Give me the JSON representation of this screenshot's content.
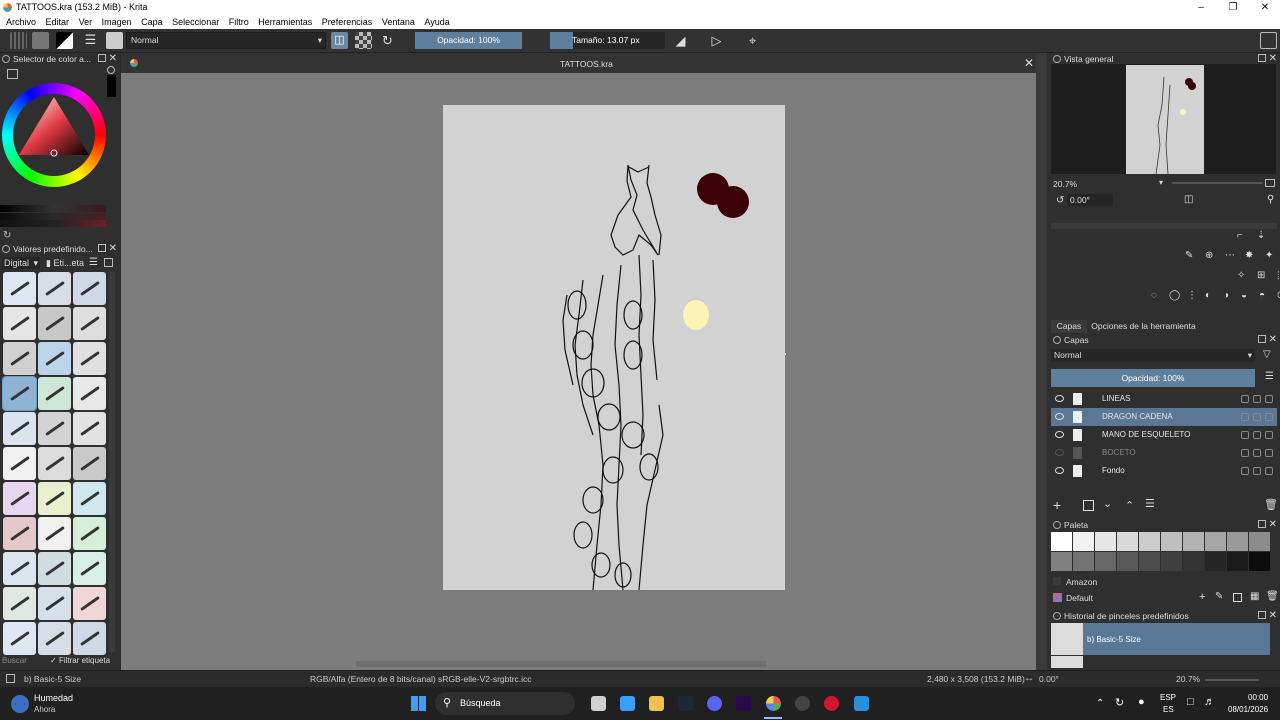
{
  "window": {
    "title": "TATTOOS.kra (153.2 MiB)  - Krita"
  },
  "menubar": [
    "Archivo",
    "Editar",
    "Ver",
    "Imagen",
    "Capa",
    "Seleccionar",
    "Filtro",
    "Herramientas",
    "Preferencias",
    "Ventana",
    "Ayuda"
  ],
  "toolbar": {
    "blend_mode": "Normal",
    "opacity": "Opacidad: 100%",
    "size": "Tamaño: 13.07 px"
  },
  "left_panels": {
    "color_selector_title": "Selector de color a...",
    "presets_title": "Valores predefinido...",
    "presets_filter": "Digital",
    "presets_tag": "Eti...eta",
    "search_placeholder": "Buscar",
    "filter_tag_label": "Filtrar etiqueta"
  },
  "canvas": {
    "tab_title": "TATTOOS.kra"
  },
  "right_panels": {
    "overview_title": "Vista general",
    "zoom": "20.7%",
    "rotation": "0.00°",
    "tabs": [
      "Capas",
      "Opciones de la herramienta"
    ],
    "layers_title": "Capas",
    "layer_blend": "Normal",
    "layer_opacity": "Opacidad:  100%",
    "layers": [
      {
        "name": "LINEAS",
        "visible": true,
        "selected": false
      },
      {
        "name": "DRAGON CADENA",
        "visible": true,
        "selected": true
      },
      {
        "name": "MANO DE ESQUELETO",
        "visible": true,
        "selected": false
      },
      {
        "name": "BOCETO",
        "visible": false,
        "selected": false
      },
      {
        "name": "Fondo",
        "visible": true,
        "selected": false
      }
    ],
    "palette_title": "Paleta",
    "palette_name": "Amazon",
    "palette_set": "Default",
    "history_title": "Historial de pinceles predefinidos",
    "history_item": "b) Basic-5 Size"
  },
  "statusbar": {
    "brush": "b) Basic-5 Size",
    "colorspace": "RGB/Alfa (Entero de 8 bits/canal)  sRGB-elle-V2-srgbtrc.icc",
    "dimensions": "2,480 x 3,508 (153.2 MiB)",
    "rotation": "0.00°",
    "zoom": "20.7%"
  },
  "taskbar": {
    "weather_title": "Humedad",
    "weather_sub": "Ahora",
    "search": "Búsqueda",
    "lang_top": "ESP",
    "lang_bottom": "ES",
    "time": "00:00",
    "date": "08/01/2026"
  },
  "colors": {
    "accent": "#5a7896",
    "canvas_bg": "#7c7c7c",
    "paper": "#d2d2d2",
    "dark_red": "#3b0006",
    "cream": "#fff3b5"
  }
}
